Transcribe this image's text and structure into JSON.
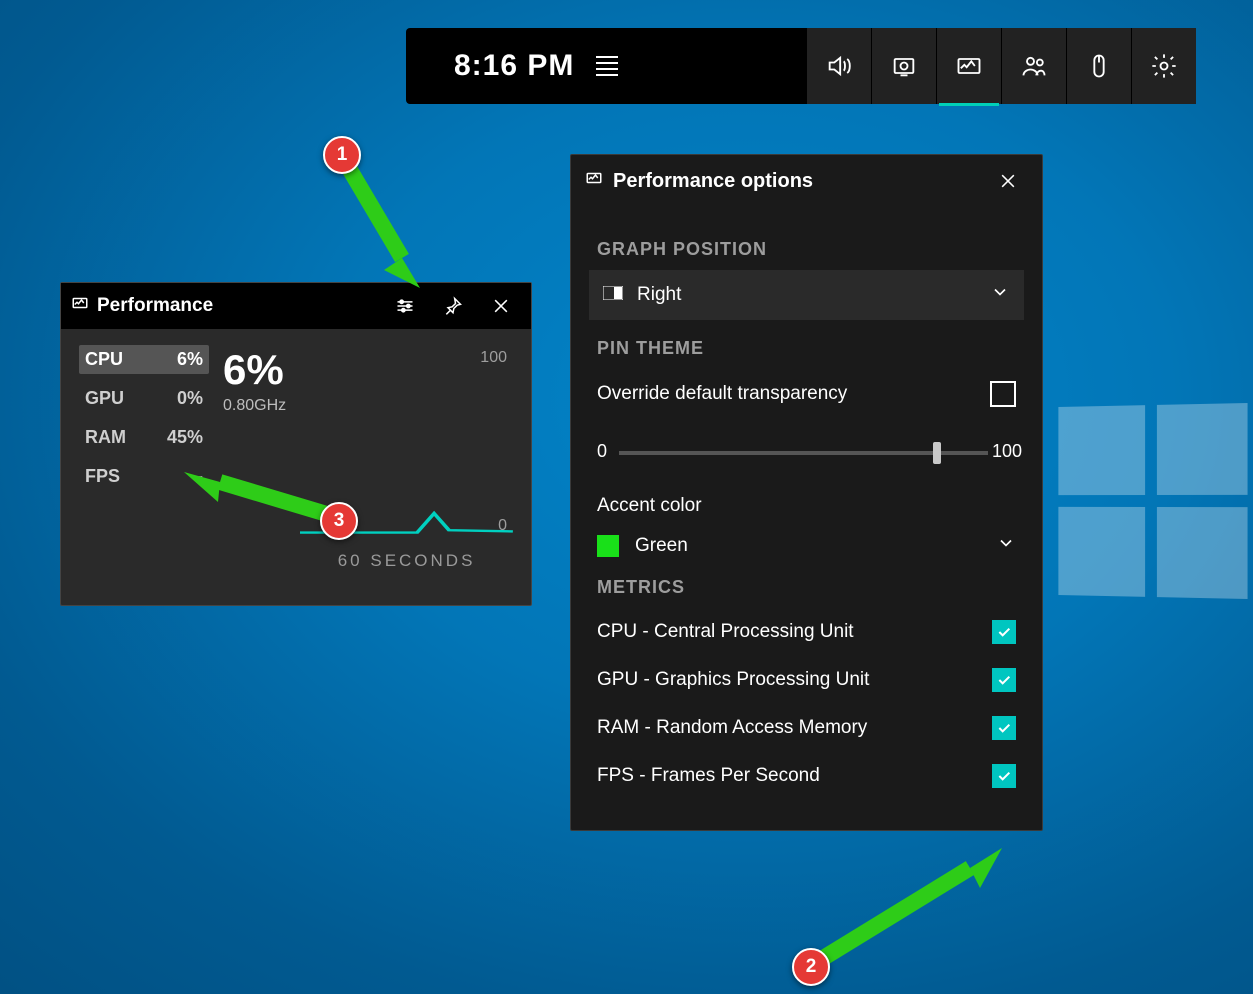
{
  "gamebar": {
    "clock": "8:16 PM"
  },
  "perf_widget": {
    "title": "Performance",
    "metrics": [
      {
        "label": "CPU",
        "value": "6%",
        "selected": true
      },
      {
        "label": "GPU",
        "value": "0%",
        "selected": false
      },
      {
        "label": "RAM",
        "value": "45%",
        "selected": false
      },
      {
        "label": "FPS",
        "value": "--",
        "selected": false
      }
    ],
    "big_value": "6%",
    "big_sub": "0.80GHz",
    "y_max": "100",
    "y_min": "0",
    "x_label": "60 SECONDS"
  },
  "options": {
    "title": "Performance options",
    "graph_position_label": "GRAPH POSITION",
    "graph_position_value": "Right",
    "pin_theme_label": "PIN THEME",
    "override_label": "Override default transparency",
    "slider_min": "0",
    "slider_max": "100",
    "slider_value": 85,
    "accent_label": "Accent color",
    "accent_value": "Green",
    "metrics_label": "METRICS",
    "metrics": [
      {
        "label": "CPU - Central Processing Unit",
        "checked": true
      },
      {
        "label": "GPU - Graphics Processing Unit",
        "checked": true
      },
      {
        "label": "RAM - Random Access Memory",
        "checked": true
      },
      {
        "label": "FPS - Frames Per Second",
        "checked": true
      }
    ]
  },
  "annotations": {
    "b1": "1",
    "b2": "2",
    "b3": "3"
  }
}
